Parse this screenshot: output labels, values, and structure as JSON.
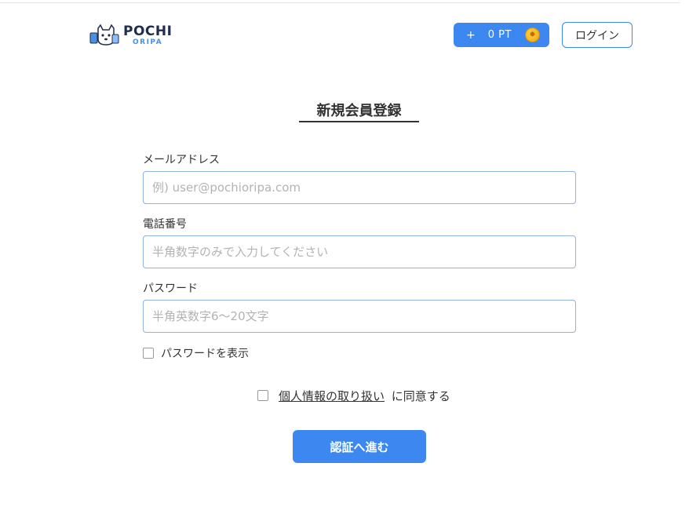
{
  "header": {
    "logo_main": "POCHI",
    "logo_sub": "ORIPA",
    "points_plus": "+",
    "points_value": "0 PT",
    "login_label": "ログイン"
  },
  "page": {
    "title": "新規会員登録"
  },
  "form": {
    "email_label": "メールアドレス",
    "email_placeholder": "例) user@pochioripa.com",
    "phone_label": "電話番号",
    "phone_placeholder": "半角数字のみで入力してください",
    "password_label": "パスワード",
    "password_placeholder": "半角英数字6～20文字",
    "show_password_label": "パスワードを表示",
    "privacy_link": "個人情報の取り扱い",
    "privacy_suffix": "に同意する",
    "submit_label": "認証へ進む"
  },
  "colors": {
    "accent": "#3d88f0",
    "input_border": "#8fb3dc",
    "logo_navy": "#1f2d4f"
  }
}
